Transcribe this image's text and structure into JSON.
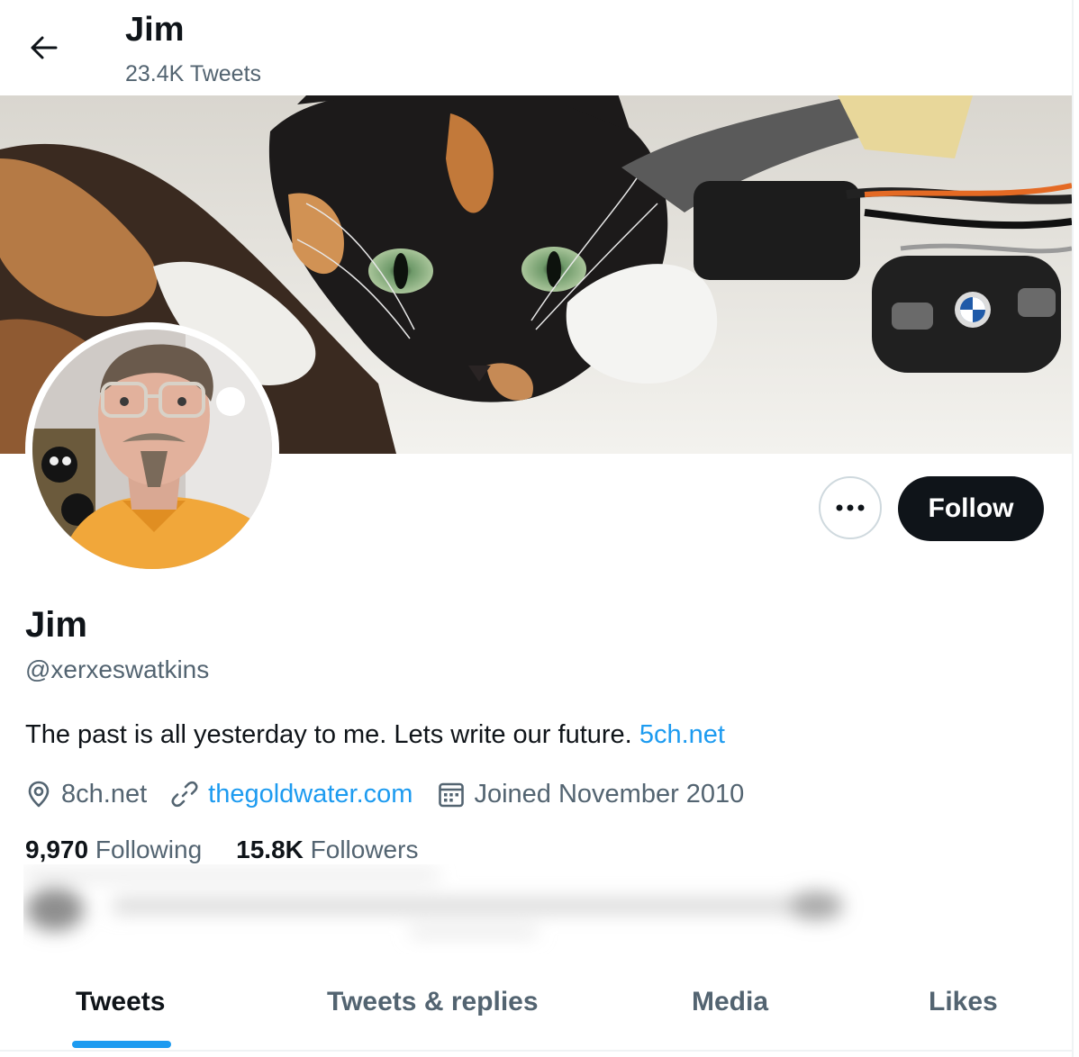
{
  "header": {
    "title": "Jim",
    "tweet_count": "23.4K Tweets"
  },
  "actions": {
    "follow_label": "Follow"
  },
  "profile": {
    "display_name": "Jim",
    "handle": "@xerxeswatkins",
    "bio_text": "The past is all yesterday to me. Lets write our future. ",
    "bio_link": "5ch.net",
    "location": "8ch.net",
    "website": "thegoldwater.com",
    "joined": "Joined November 2010",
    "following_count": "9,970",
    "following_label": "Following",
    "followers_count": "15.8K",
    "followers_label": "Followers"
  },
  "tabs": [
    {
      "label": "Tweets",
      "active": true
    },
    {
      "label": "Tweets & replies",
      "active": false
    },
    {
      "label": "Media",
      "active": false
    },
    {
      "label": "Likes",
      "active": false
    }
  ],
  "colors": {
    "accent": "#1d9bf0",
    "text_primary": "#0f1419",
    "text_secondary": "#536471",
    "follow_bg": "#0f1419"
  },
  "icons": {
    "back": "arrow-left-icon",
    "more": "ellipsis-icon",
    "location": "map-pin-icon",
    "website": "link-icon",
    "joined": "calendar-icon"
  }
}
